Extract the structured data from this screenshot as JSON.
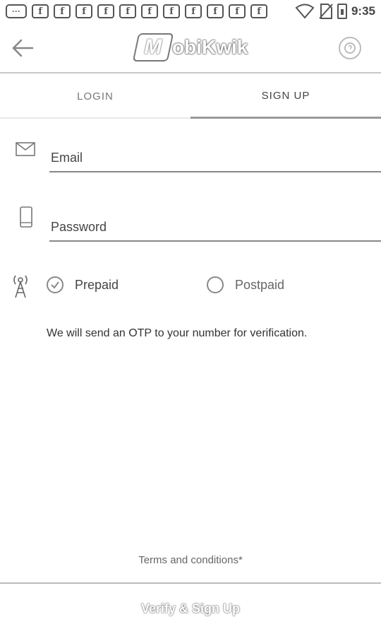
{
  "status_bar": {
    "notification_more_label": "···",
    "notification_app_letter": "f",
    "notification_count": 11,
    "time": "9:35"
  },
  "header": {
    "logo_mark": "M",
    "logo_text": "obiKwik",
    "back_icon": "arrow-left-icon",
    "help_icon": "help-circle-icon"
  },
  "tabs": [
    {
      "label": "LOGIN",
      "active": false
    },
    {
      "label": "SIGN UP",
      "active": true
    }
  ],
  "form": {
    "email": {
      "placeholder": "Email",
      "value": "",
      "icon": "mail-icon"
    },
    "password": {
      "placeholder": "Password",
      "value": "",
      "icon": "phone-icon"
    },
    "connection_icon": "signal-tower-icon",
    "connection_options": [
      {
        "label": "Prepaid",
        "selected": true
      },
      {
        "label": "Postpaid",
        "selected": false
      }
    ],
    "otp_note": "We will send an OTP to your number for verification."
  },
  "footer": {
    "terms_label": "Terms and conditions*",
    "submit_label": "Verify & Sign Up"
  }
}
